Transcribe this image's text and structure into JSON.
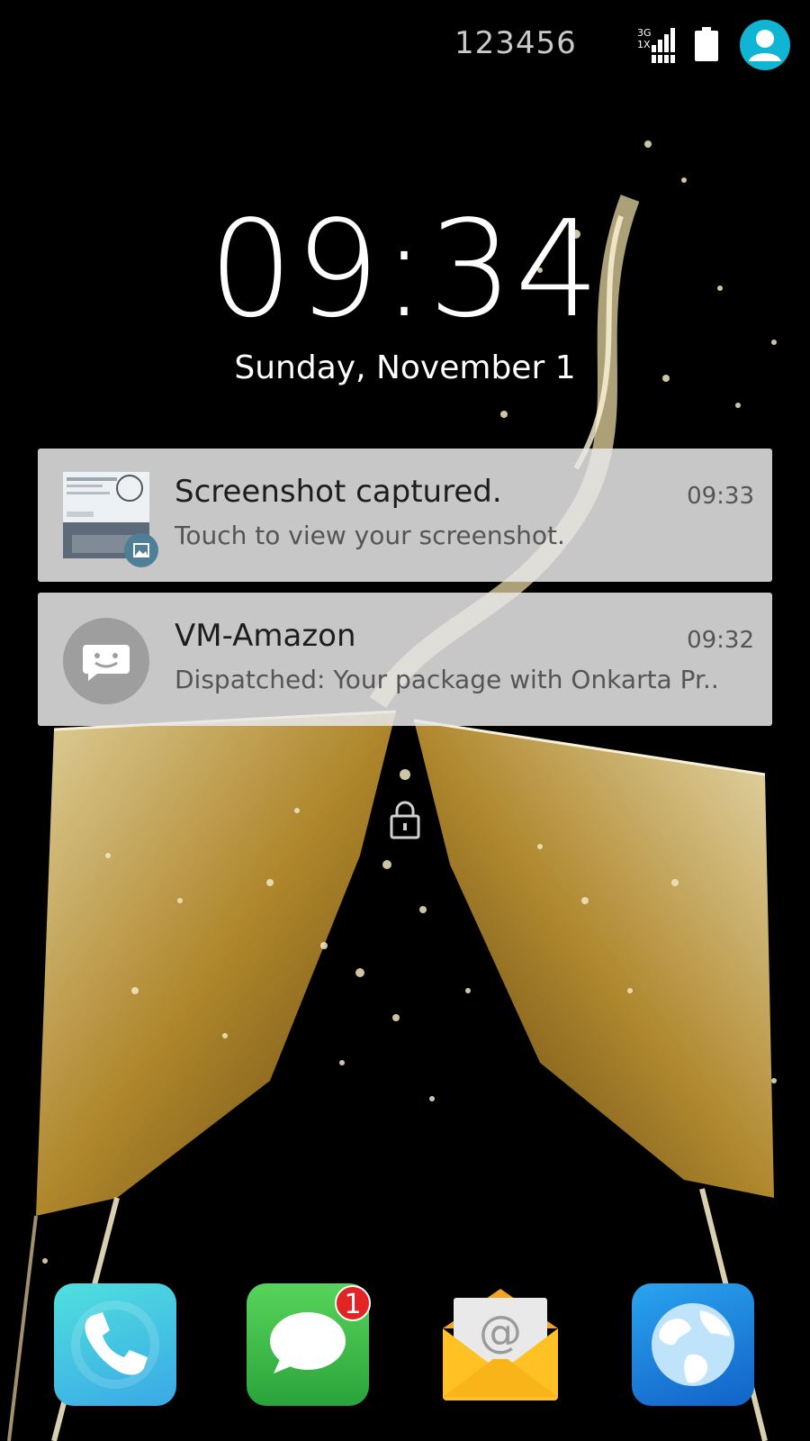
{
  "status_bar": {
    "carrier": "123456",
    "signal_icon": "signal-3g-1x-icon",
    "signal_labels": [
      "3G",
      "1X"
    ],
    "battery_icon": "battery-icon",
    "avatar_icon": "user-avatar-icon",
    "avatar_color": "#0fb5d3"
  },
  "lockscreen": {
    "time": "09:34",
    "date": "Sunday, November 1"
  },
  "notifications": [
    {
      "icon": "screenshot-thumbnail",
      "title": "Screenshot captured.",
      "body": "Touch to view your screenshot.",
      "time": "09:33"
    },
    {
      "icon": "message-icon",
      "title": "VM-Amazon",
      "body": "Dispatched: Your package with Onkarta Pr..",
      "time": "09:32"
    }
  ],
  "dock": {
    "apps": [
      {
        "name": "phone",
        "icon": "phone-icon"
      },
      {
        "name": "messages",
        "icon": "chat-bubble-icon",
        "badge": "1"
      },
      {
        "name": "email",
        "icon": "email-envelope-icon"
      },
      {
        "name": "browser",
        "icon": "globe-icon"
      }
    ]
  },
  "colors": {
    "notification_bg": "#e8e8e8",
    "badge_red": "#e22424"
  }
}
